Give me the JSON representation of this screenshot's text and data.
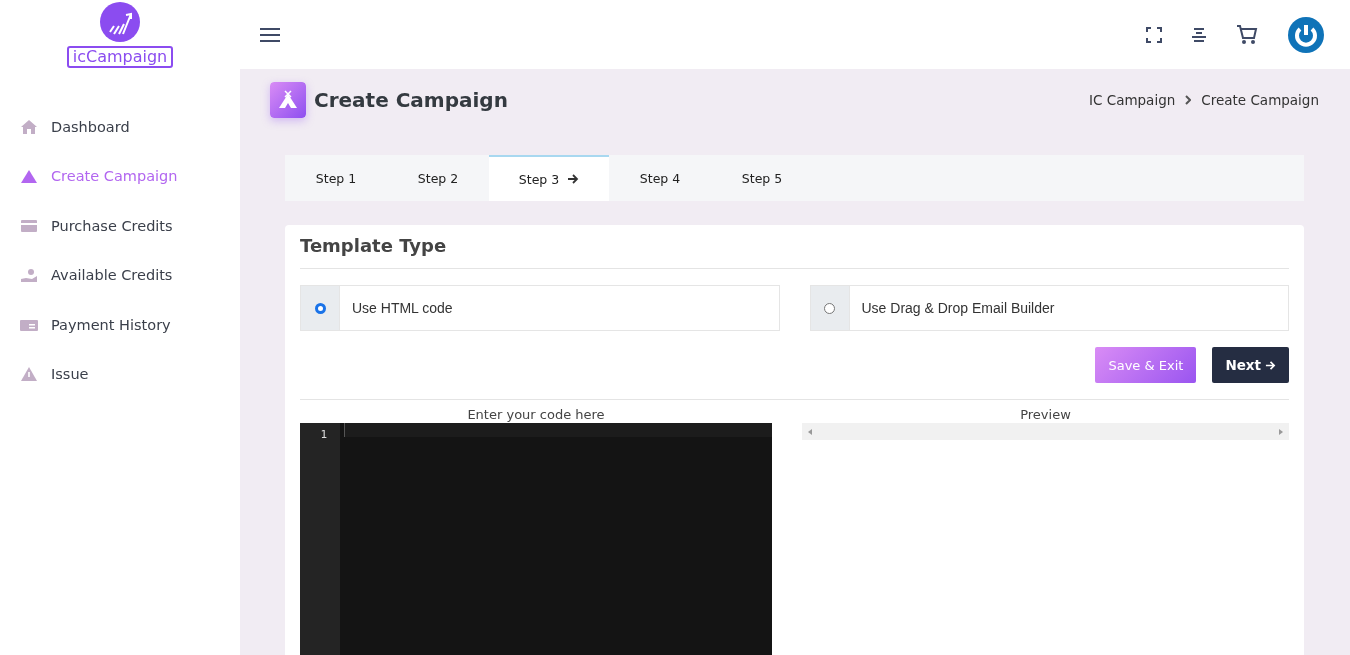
{
  "logo": {
    "text": "icCampaign"
  },
  "sidebar": {
    "items": [
      {
        "label": "Dashboard",
        "kind": "home",
        "selected": false
      },
      {
        "label": "Create Campaign",
        "kind": "mountain",
        "selected": true
      },
      {
        "label": "Purchase Credits",
        "kind": "card",
        "selected": false
      },
      {
        "label": "Available Credits",
        "kind": "hand",
        "selected": false
      },
      {
        "label": "Payment History",
        "kind": "bill",
        "selected": false
      },
      {
        "label": "Issue",
        "kind": "warning",
        "selected": false
      }
    ]
  },
  "page": {
    "title": "Create Campaign",
    "breadcrumb": [
      "IC Campaign",
      "Create Campaign"
    ]
  },
  "steps": [
    {
      "label": "Step 1",
      "selected": false
    },
    {
      "label": "Step 2",
      "selected": false
    },
    {
      "label": "Step 3",
      "selected": true
    },
    {
      "label": "Step 4",
      "selected": false
    },
    {
      "label": "Step 5",
      "selected": false
    }
  ],
  "card": {
    "title": "Template Type",
    "options": [
      {
        "label": "Use HTML code",
        "selected": true
      },
      {
        "label": "Use Drag & Drop Email Builder",
        "selected": false
      }
    ],
    "buttons": [
      {
        "label": "Save & Exit",
        "kind": "secondary"
      },
      {
        "label": "Next",
        "kind": "primary"
      }
    ],
    "editor": {
      "heading": "Enter your code here",
      "line_number": "1"
    },
    "preview": {
      "heading": "Preview"
    }
  }
}
